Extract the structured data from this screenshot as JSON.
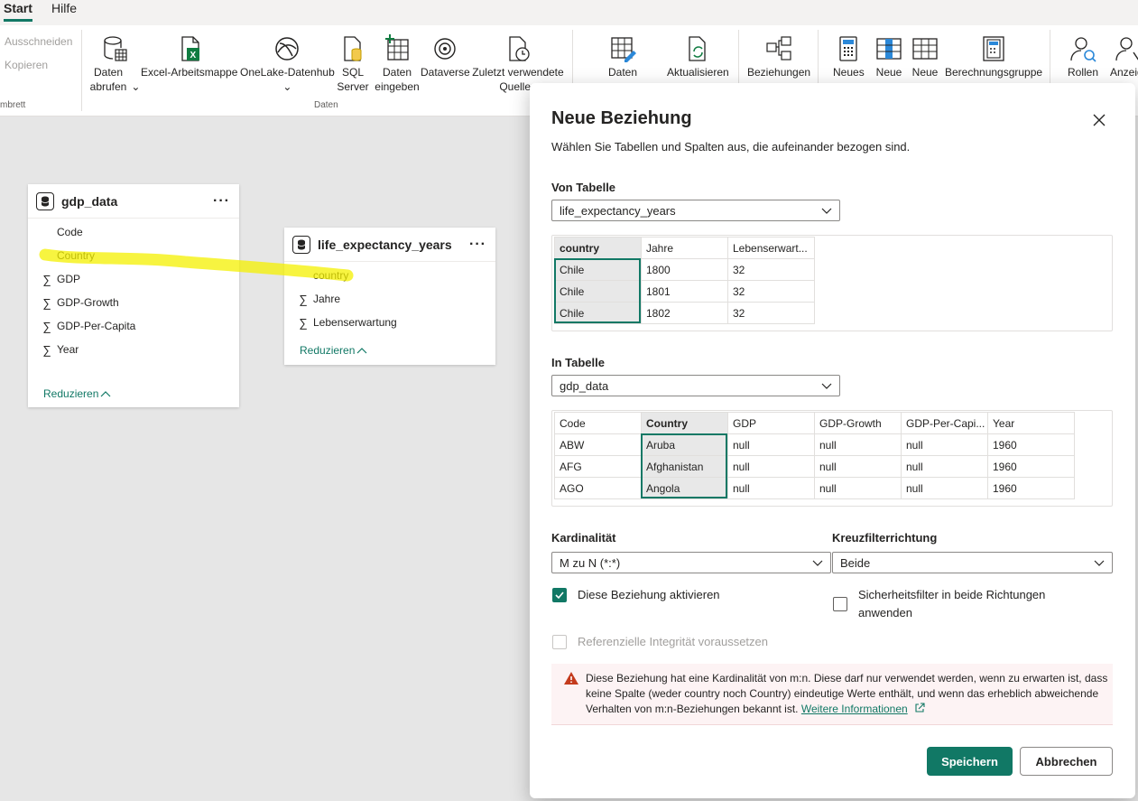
{
  "ribbon": {
    "tabs": [
      "Start",
      "Hilfe"
    ],
    "clipboard": {
      "cut": "Ausschneiden",
      "copy": "Kopieren",
      "group": "mbrett"
    },
    "items": {
      "daten_abrufen": "Daten abrufen",
      "excel": "Excel-Arbeitsmappe",
      "onelake": "OneLake-Datenhub",
      "sql": "SQL Server",
      "daten_eingeben": "Daten eingeben",
      "dataverse": "Dataverse",
      "zuletzt": "Zuletzt verwendete Quellen",
      "daten": "Daten",
      "aktualisieren": "Aktualisieren",
      "beziehungen": "Beziehungen",
      "neues": "Neues",
      "neue1": "Neue",
      "neue2": "Neue",
      "berechnungsgruppe": "Berechnungsgruppe",
      "rollen": "Rollen",
      "anzeigen": "Anzeig"
    },
    "group_daten": "Daten"
  },
  "tables": {
    "gdp": {
      "name": "gdp_data",
      "fields": [
        {
          "label": "Code",
          "sigma": false
        },
        {
          "label": "Country",
          "sigma": false
        },
        {
          "label": "GDP",
          "sigma": true
        },
        {
          "label": "GDP-Growth",
          "sigma": true
        },
        {
          "label": "GDP-Per-Capita",
          "sigma": true
        },
        {
          "label": "Year",
          "sigma": true
        }
      ],
      "reduce": "Reduzieren"
    },
    "life": {
      "name": "life_expectancy_years",
      "fields": [
        {
          "label": "country",
          "sigma": false
        },
        {
          "label": "Jahre",
          "sigma": true
        },
        {
          "label": "Lebenserwartung",
          "sigma": true
        }
      ],
      "reduce": "Reduzieren"
    }
  },
  "dialog": {
    "title": "Neue Beziehung",
    "subtitle": "Wählen Sie Tabellen und Spalten aus, die aufeinander bezogen sind.",
    "from": {
      "label": "Von Tabelle",
      "table": "life_expectancy_years",
      "headers": [
        "country",
        "Jahre",
        "Lebenserwart..."
      ],
      "rows": [
        [
          "Chile",
          "1800",
          "32"
        ],
        [
          "Chile",
          "1801",
          "32"
        ],
        [
          "Chile",
          "1802",
          "32"
        ]
      ]
    },
    "to": {
      "label": "In Tabelle",
      "table": "gdp_data",
      "headers": [
        "Code",
        "Country",
        "GDP",
        "GDP-Growth",
        "GDP-Per-Capi...",
        "Year"
      ],
      "rows": [
        [
          "ABW",
          "Aruba",
          "null",
          "null",
          "null",
          "1960"
        ],
        [
          "AFG",
          "Afghanistan",
          "null",
          "null",
          "null",
          "1960"
        ],
        [
          "AGO",
          "Angola",
          "null",
          "null",
          "null",
          "1960"
        ]
      ]
    },
    "cardinality": {
      "label": "Kardinalität",
      "value": "M zu N (*:*)"
    },
    "crossfilter": {
      "label": "Kreuzfilterrichtung",
      "value": "Beide"
    },
    "activate": {
      "label": "Diese Beziehung aktivieren",
      "checked": true
    },
    "security": {
      "label": "Sicherheitsfilter in beide Richtungen anwenden",
      "checked": false
    },
    "integrity": {
      "label": "Referenzielle Integrität voraussetzen",
      "checked": false
    },
    "warning": {
      "text": "Diese Beziehung hat eine Kardinalität von m:n. Diese darf nur verwendet werden, wenn zu erwarten ist, dass keine Spalte (weder country noch Country) eindeutige Werte enthält, und wenn das erheblich abweichende Verhalten von m:n-Beziehungen bekannt ist.",
      "link": "Weitere Informationen"
    },
    "save": "Speichern",
    "cancel": "Abbrechen"
  },
  "colors": {
    "accent": "#117865",
    "highlight": "#f4f000",
    "warning_icon": "#c43b1d"
  }
}
